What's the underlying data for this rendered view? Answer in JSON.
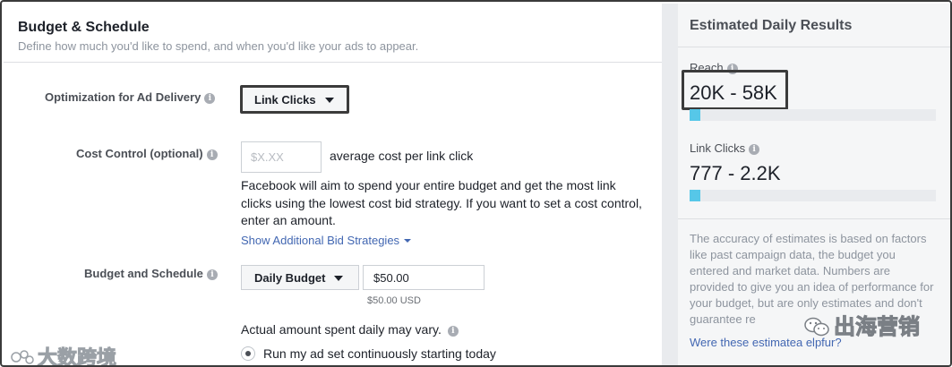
{
  "section": {
    "title": "Budget & Schedule",
    "subtitle": "Define how much you'd like to spend, and when you'd like your ads to appear."
  },
  "optimization": {
    "label": "Optimization for Ad Delivery",
    "value": "Link Clicks"
  },
  "cost_control": {
    "label": "Cost Control (optional)",
    "placeholder": "$X.XX",
    "suffix": "average cost per link click",
    "description": "Facebook will aim to spend your entire budget and get the most link clicks using the lowest cost bid strategy. If you want to set a cost control, enter an amount.",
    "more_link": "Show Additional Bid Strategies"
  },
  "budget": {
    "label": "Budget and Schedule",
    "type": "Daily Budget",
    "amount": "$50.00",
    "amount_usd": "$50.00 USD",
    "vary_note": "Actual amount spent daily may vary.",
    "schedule_option": "Run my ad set continuously starting today"
  },
  "estimates": {
    "title": "Estimated Daily Results",
    "reach_label": "Reach",
    "reach_value": "20K - 58K",
    "reach_fill": 0.045,
    "clicks_label": "Link Clicks",
    "clicks_value": "777 - 2.2K",
    "clicks_fill": 0.045,
    "note": "The accuracy of estimates is based on factors like past campaign data, the budget you entered and market data. Numbers are provided to give you an idea of performance for your budget, but are only estimates and don't guarantee re",
    "helpful_link": "Were these estimatea  elpfur?",
    "bar_color": "#56c7e8"
  },
  "watermarks": {
    "left": "大数跨境",
    "right": "出海营销"
  },
  "icons": [
    "info-icon",
    "caret-down-icon",
    "radio-icon",
    "wechat-icon",
    "logo-icon"
  ]
}
